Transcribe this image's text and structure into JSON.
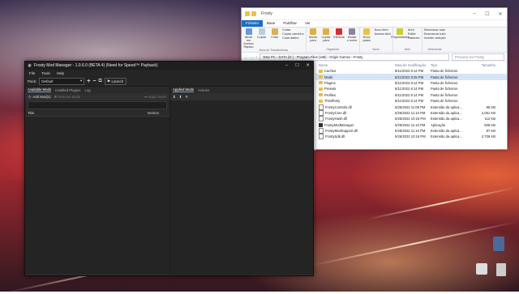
{
  "explorer": {
    "title": "Frosty",
    "tabs": [
      "Ficheiro",
      "Base",
      "Partilhar",
      "Ver"
    ],
    "ribbon": {
      "clipboard": {
        "name": "Área de Transferência",
        "pin": "Afixar em Acesso Rápido",
        "copy": "Copiar",
        "paste": "Colar",
        "cut": "Cortar",
        "copy_path": "Copiar caminho",
        "paste_shortcut": "Colar atalho"
      },
      "organize": {
        "name": "Organizar",
        "move": "Mover para",
        "copy_to": "Copiar para",
        "delete": "Eliminar",
        "rename": "Mudar o nome"
      },
      "new": {
        "name": "Novo",
        "new_folder": "Nova pasta",
        "new_item": "Novo item",
        "easy_access": "Acesso fácil"
      },
      "open": {
        "name": "Abrir",
        "properties": "Propriedades",
        "open": "Abrir",
        "edit": "Editar",
        "history": "Histórico"
      },
      "select": {
        "name": "Selecionar",
        "select_all": "Selecionar tudo",
        "select_none": "Desmarcar tudo",
        "invert": "Inverter seleção"
      }
    },
    "path": "Este PC  ›  DATA (D:)  ›  Program Files (x86)  ›  Origin Games  ›  Frosty",
    "search_placeholder": "Procurar em Frosty",
    "columns": {
      "name": "Nome",
      "date": "Data de modificação",
      "type": "Tipo",
      "size": "Tamanho"
    },
    "files": [
      {
        "name": "Caches",
        "date": "8/11/2022 8:14 PM",
        "type": "Pasta de ficheiros",
        "size": "",
        "kind": "folder"
      },
      {
        "name": "Mods",
        "date": "8/11/2022 8:25 PM",
        "type": "Pasta de ficheiros",
        "size": "",
        "kind": "folder",
        "selected": true
      },
      {
        "name": "Plugins",
        "date": "8/11/2022 8:14 PM",
        "type": "Pasta de ficheiros",
        "size": "",
        "kind": "folder"
      },
      {
        "name": "Presets",
        "date": "8/11/2022 8:14 PM",
        "type": "Pasta de ficheiros",
        "size": "",
        "kind": "folder"
      },
      {
        "name": "Profiles",
        "date": "8/11/2022 8:14 PM",
        "type": "Pasta de ficheiros",
        "size": "",
        "kind": "folder"
      },
      {
        "name": "ThirdParty",
        "date": "8/11/2022 8:14 PM",
        "type": "Pasta de ficheiros",
        "size": "",
        "kind": "folder"
      },
      {
        "name": "FrostyControls.dll",
        "date": "5/26/2022 11:08 PM",
        "type": "Extensão da aplica...",
        "size": "95 KB",
        "kind": "file"
      },
      {
        "name": "FrostyCore.dll",
        "date": "5/26/2022 11:10 PM",
        "type": "Extensão da aplica...",
        "size": "4,051 KB",
        "kind": "file"
      },
      {
        "name": "FrostyHash.dll",
        "date": "5/26/2022 10:16 PM",
        "type": "Extensão da aplica...",
        "size": "112 KB",
        "kind": "file"
      },
      {
        "name": "FrostyModManager",
        "date": "5/26/2022 11:10 PM",
        "type": "Aplicação",
        "size": "506 KB",
        "kind": "app"
      },
      {
        "name": "FrostyModSupport.dll",
        "date": "5/26/2022 11:10 PM",
        "type": "Extensão da aplica...",
        "size": "87 KB",
        "kind": "file"
      },
      {
        "name": "FrostySdk.dll",
        "date": "5/26/2022 10:16 PM",
        "type": "Extensão da aplica...",
        "size": "2,706 KB",
        "kind": "file"
      }
    ]
  },
  "frosty": {
    "title": "Frosty Mod Manager - 1.0.6.0 (BETA 4) (Need for Speed™ Payback)",
    "menu": [
      "File",
      "Tools",
      "Help"
    ],
    "pack_label": "Pack:",
    "pack_value": "Default",
    "launch": "Launch",
    "left_tabs": [
      "Available Mods",
      "Installed Plugins",
      "Log"
    ],
    "add_mods": "Add Mod(s)",
    "remove_mods": "Remove Mods",
    "apply_mods": "Apply Mods",
    "col_title": "Title",
    "col_version": "Version",
    "right_tabs": [
      "Applied Mods",
      "Actions"
    ]
  }
}
